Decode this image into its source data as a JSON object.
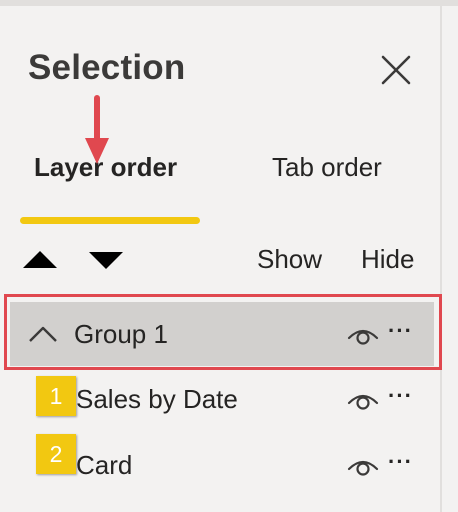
{
  "panel": {
    "title": "Selection",
    "tabs": [
      {
        "label": "Layer order",
        "active": true
      },
      {
        "label": "Tab order",
        "active": false
      }
    ],
    "columns": {
      "show": "Show",
      "hide": "Hide"
    },
    "group": {
      "label": "Group 1",
      "more": "···"
    },
    "items": [
      {
        "label": "Sales by Date",
        "badge": "1",
        "more": "···"
      },
      {
        "label": "Card",
        "badge": "2",
        "more": "···"
      }
    ]
  },
  "colors": {
    "accent_underline": "#f2c811",
    "annotation_red": "#e0484f",
    "badge_yellow": "#f2c811",
    "group_background": "#d2d0ce",
    "panel_background": "#f3f2f1"
  },
  "icons": {
    "close": "close-icon",
    "move_up": "triangle-up-icon",
    "move_down": "triangle-down-icon",
    "collapse": "chevron-up-icon",
    "visibility": "eye-icon",
    "more": "more-options-icon",
    "annotation_arrow": "red-arrow-down-icon"
  }
}
